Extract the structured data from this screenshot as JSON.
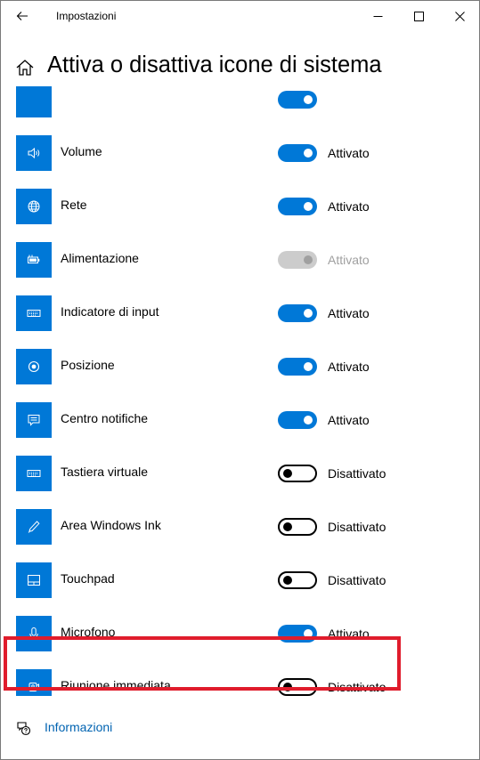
{
  "titlebar": {
    "title": "Impostazioni"
  },
  "page": {
    "title": "Attiva o disattiva icone di sistema"
  },
  "settings": [
    {
      "label": "",
      "icon": "generic-icon",
      "state": "",
      "status": "on"
    },
    {
      "label": "Volume",
      "icon": "volume-icon",
      "state": "Attivato",
      "status": "on"
    },
    {
      "label": "Rete",
      "icon": "network-globe-icon",
      "state": "Attivato",
      "status": "on"
    },
    {
      "label": "Alimentazione",
      "icon": "battery-icon",
      "state": "Attivato",
      "status": "disabled"
    },
    {
      "label": "Indicatore di input",
      "icon": "keyboard-icon",
      "state": "Attivato",
      "status": "on"
    },
    {
      "label": "Posizione",
      "icon": "location-icon",
      "state": "Attivato",
      "status": "on"
    },
    {
      "label": "Centro notifiche",
      "icon": "action-center-icon",
      "state": "Attivato",
      "status": "on"
    },
    {
      "label": "Tastiera virtuale",
      "icon": "touch-keyboard-icon",
      "state": "Disattivato",
      "status": "off"
    },
    {
      "label": "Area Windows Ink",
      "icon": "pen-icon",
      "state": "Disattivato",
      "status": "off"
    },
    {
      "label": "Touchpad",
      "icon": "touchpad-icon",
      "state": "Disattivato",
      "status": "off"
    },
    {
      "label": "Microfono",
      "icon": "microphone-icon",
      "state": "Attivato",
      "status": "on"
    },
    {
      "label": "Riunione immediata",
      "icon": "meet-now-icon",
      "state": "Disattivato",
      "status": "off"
    }
  ],
  "footer": {
    "info_label": "Informazioni",
    "icon": "help-icon"
  },
  "colors": {
    "accent": "#0078d7",
    "link": "#0063b1",
    "highlight": "#e01c2c",
    "disabled": "#a0a0a0"
  }
}
